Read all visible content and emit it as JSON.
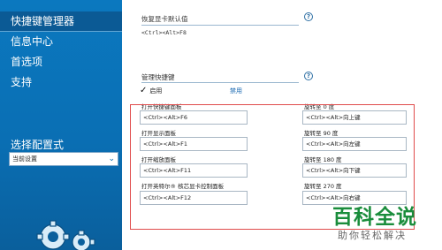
{
  "sidebar": {
    "items": [
      {
        "label": "快捷键管理器",
        "active": true
      },
      {
        "label": "信息中心",
        "active": false
      },
      {
        "label": "首选项",
        "active": false
      },
      {
        "label": "支持",
        "active": false
      }
    ],
    "config_label": "选择配置式",
    "config_selected": "当前设置"
  },
  "restore": {
    "title": "恢复显卡默认值",
    "shortcut": "<Ctrl><Alt>F8"
  },
  "manage": {
    "title": "管理快捷键",
    "enable_label": "启用",
    "disable_link": "禁用"
  },
  "shortcuts_left": [
    {
      "label": "打开快捷键面板",
      "value": "<Ctrl><Alt>F6"
    },
    {
      "label": "打开显示面板",
      "value": "<Ctrl><Alt>F1"
    },
    {
      "label": "打开缩放面板",
      "value": "<Ctrl><Alt>F11"
    },
    {
      "label": "打开英特尔® 核芯显卡控制面板",
      "value": "<Ctrl><Alt>F12"
    }
  ],
  "shortcuts_right": [
    {
      "label": "旋转至 0 度",
      "value": "<Ctrl><Alt>向上键"
    },
    {
      "label": "旋转至 90 度",
      "value": "<Ctrl><Alt>向左键"
    },
    {
      "label": "旋转至 180 度",
      "value": "<Ctrl><Alt>向下键"
    },
    {
      "label": "旋转至 270 度",
      "value": "<Ctrl><Alt>向右键"
    }
  ],
  "watermark": {
    "title": "百科全说",
    "subtitle": "助你轻松解决"
  },
  "colors": {
    "sidebar_blue": "#0a6fb4",
    "highlight_red": "#e04b4b",
    "link_blue": "#1767b0",
    "watermark_green": "#1a8d3c"
  }
}
